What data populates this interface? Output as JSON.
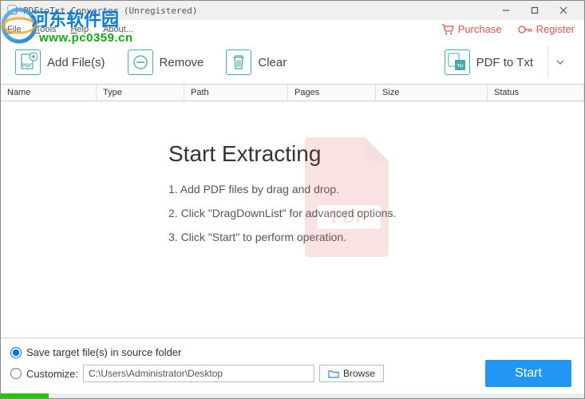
{
  "window": {
    "title": "PDFtoTxt Converter (Unregistered)"
  },
  "menu": {
    "file": "File",
    "tools": "Tools",
    "help": "Help",
    "about": "About..."
  },
  "header_links": {
    "purchase": "Purchase",
    "register": "Register"
  },
  "toolbar": {
    "add": "Add File(s)",
    "remove": "Remove",
    "clear": "Clear",
    "convert": "PDF to Txt"
  },
  "table": {
    "name": "Name",
    "type": "Type",
    "path": "Path",
    "pages": "Pages",
    "size": "Size",
    "status": "Status"
  },
  "empty_state": {
    "heading": "Start Extracting",
    "step1": "1. Add PDF files by drag and drop.",
    "step2": "2. Click \"DragDownList\" for advanced options.",
    "step3": "3. Click \"Start\" to perform operation."
  },
  "footer": {
    "save_source": "Save target file(s) in source folder",
    "customize": "Customize:",
    "path_value": "C:\\Users\\Administrator\\Desktop",
    "browse": "Browse",
    "start": "Start"
  },
  "watermark": {
    "line1": "河东软件园",
    "line2": "www.pc0359.cn"
  }
}
